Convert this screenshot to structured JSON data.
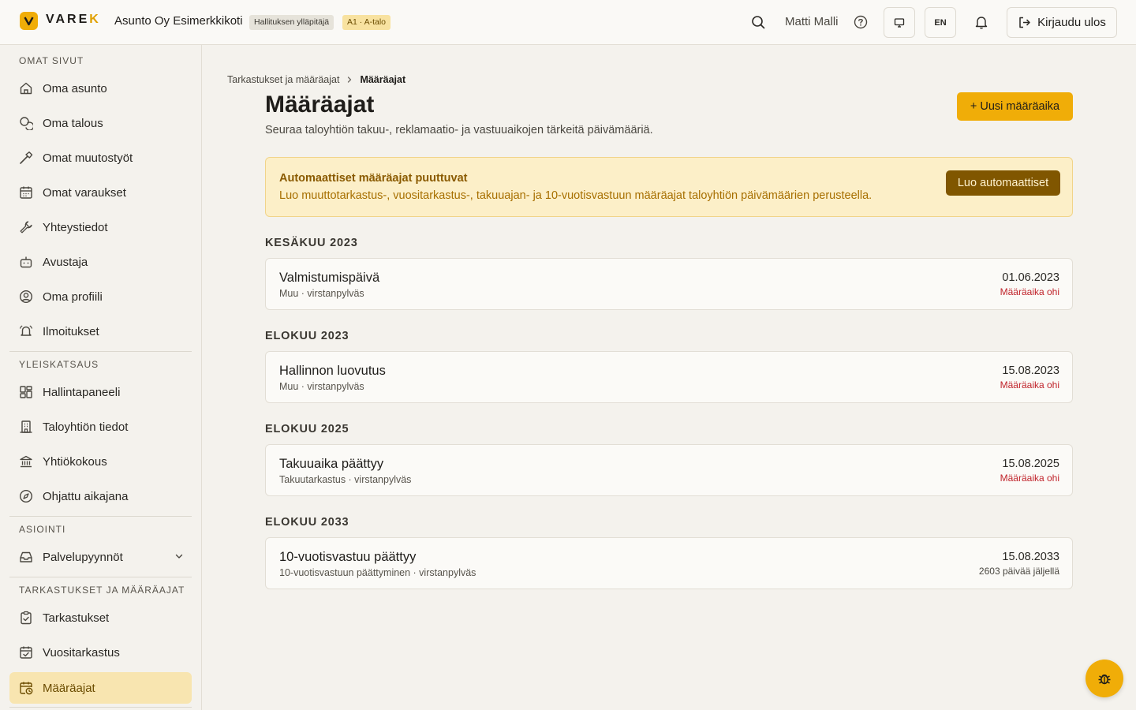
{
  "header": {
    "logo_text": "VARE",
    "logo_accent": "K",
    "company": "Asunto Oy Esimerkkikoti",
    "role_badge": "Hallituksen ylläpitäjä",
    "unit_badge": "A1 · A-talo",
    "user_name": "Matti Malli",
    "language": "EN",
    "logout_label": "Kirjaudu ulos",
    "icons": [
      "search-icon",
      "help-icon",
      "monitor-icon",
      "bell-icon",
      "logout-icon"
    ]
  },
  "sidebar": {
    "sections": [
      {
        "title": "OMAT SIVUT",
        "items": [
          {
            "label": "Oma asunto",
            "icon": "home-icon"
          },
          {
            "label": "Oma talous",
            "icon": "coins-icon"
          },
          {
            "label": "Omat muutostyöt",
            "icon": "hammer-icon"
          },
          {
            "label": "Omat varaukset",
            "icon": "calendar-icon"
          },
          {
            "label": "Yhteystiedot",
            "icon": "wrench-icon"
          },
          {
            "label": "Avustaja",
            "icon": "bot-icon"
          },
          {
            "label": "Oma profiili",
            "icon": "user-circle-icon"
          },
          {
            "label": "Ilmoitukset",
            "icon": "bell-ring-icon"
          }
        ]
      },
      {
        "title": "YLEISKATSAUS",
        "items": [
          {
            "label": "Hallintapaneeli",
            "icon": "dashboard-icon"
          },
          {
            "label": "Taloyhtiön tiedot",
            "icon": "building-icon"
          },
          {
            "label": "Yhtiökokous",
            "icon": "landmark-icon"
          },
          {
            "label": "Ohjattu aikajana",
            "icon": "compass-icon"
          }
        ]
      },
      {
        "title": "ASIOINTI",
        "items": [
          {
            "label": "Palvelupyynnöt",
            "icon": "inbox-icon"
          }
        ]
      },
      {
        "title": "TARKASTUKSET JA MÄÄRÄAJAT",
        "items": [
          {
            "label": "Tarkastukset",
            "icon": "clipboard-check-icon"
          },
          {
            "label": "Vuositarkastus",
            "icon": "calendar-check-icon"
          },
          {
            "label": "Määräajat",
            "icon": "calendar-clock-icon",
            "active": true
          }
        ]
      }
    ]
  },
  "breadcrumb": {
    "parent": "Tarkastukset ja määräajat",
    "current": "Määräajat"
  },
  "page": {
    "title": "Määräajat",
    "subtitle": "Seuraa taloyhtiön takuu-, reklamaatio- ja vastuuaikojen tärkeitä päivämääriä.",
    "new_button": "+ Uusi määräaika"
  },
  "alert": {
    "title": "Automaattiset määräajat puuttuvat",
    "text": "Luo muuttotarkastus-, vuositarkastus-, takuuajan- ja 10-vuotisvastuun määräajat taloyhtiön päivämäärien perusteella.",
    "button": "Luo automaattiset"
  },
  "groups": [
    {
      "title": "KESÄKUU 2023",
      "items": [
        {
          "title": "Valmistumispäivä",
          "meta": "Muu · virstanpylväs",
          "date": "01.06.2023",
          "status": "Määräaika ohi",
          "overdue": true
        }
      ]
    },
    {
      "title": "ELOKUU 2023",
      "items": [
        {
          "title": "Hallinnon luovutus",
          "meta": "Muu · virstanpylväs",
          "date": "15.08.2023",
          "status": "Määräaika ohi",
          "overdue": true
        }
      ]
    },
    {
      "title": "ELOKUU 2025",
      "items": [
        {
          "title": "Takuuaika päättyy",
          "meta": "Takuutarkastus · virstanpylväs",
          "date": "15.08.2025",
          "status": "Määräaika ohi",
          "overdue": true
        }
      ]
    },
    {
      "title": "ELOKUU 2033",
      "items": [
        {
          "title": "10-vuotisvastuu päättyy",
          "meta": "10-vuotisvastuun päättyminen · virstanpylväs",
          "date": "15.08.2033",
          "status": "2603 päivää jäljellä",
          "overdue": false
        }
      ]
    }
  ],
  "colors": {
    "accent": "#f0ad08",
    "active_bg": "#f8e5b0",
    "overdue": "#c0242b",
    "alert_bg": "#fcefc8"
  },
  "fab_icon": "bug-icon"
}
